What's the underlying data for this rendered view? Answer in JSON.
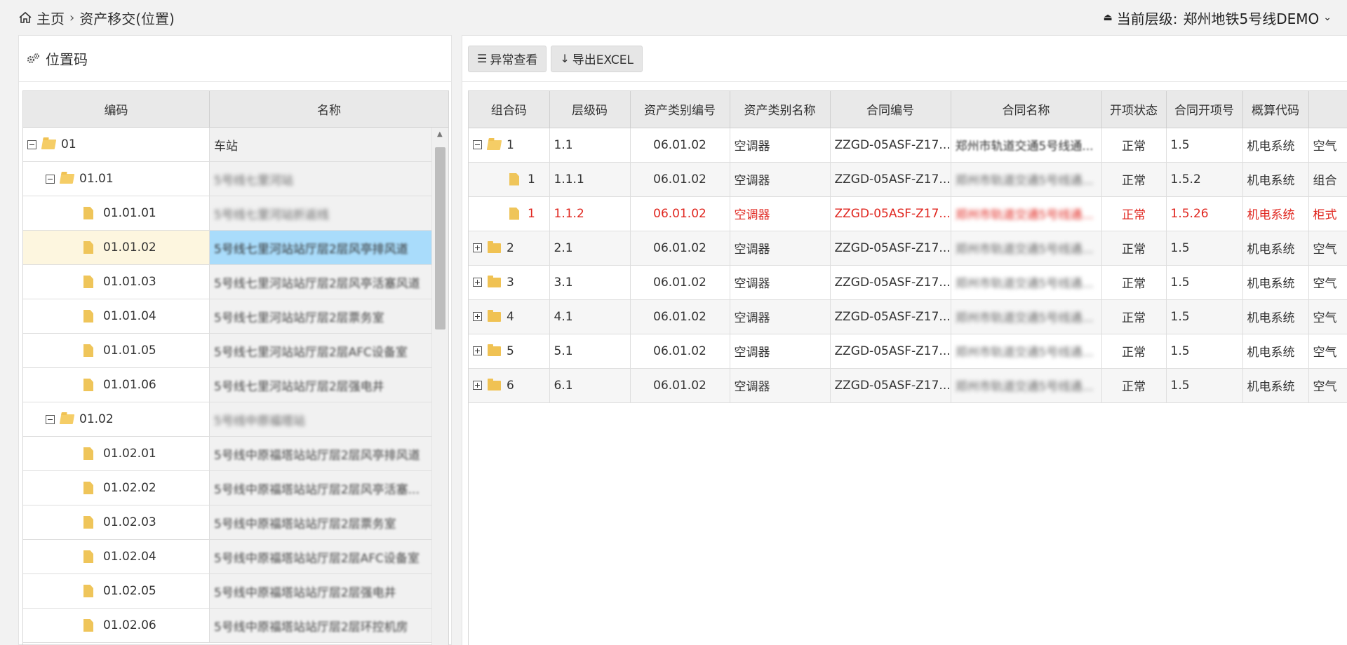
{
  "breadcrumb": {
    "home": "主页",
    "sep": "›",
    "current": "资产移交(位置)"
  },
  "level": {
    "label": "当前层级:",
    "value": "郑州地铁5号线DEMO"
  },
  "left_panel": {
    "title": "位置码",
    "columns": {
      "code": "编码",
      "name": "名称"
    },
    "rows": [
      {
        "code": "01",
        "name": "车站"
      },
      {
        "code": "01.01",
        "name": "5号线七里河站"
      },
      {
        "code": "01.01.01",
        "name": "5号线七里河站折返线"
      },
      {
        "code": "01.01.02",
        "name": "5号线七里河站站厅层2层风亭排风道"
      },
      {
        "code": "01.01.03",
        "name": "5号线七里河站站厅层2层风亭活塞风道"
      },
      {
        "code": "01.01.04",
        "name": "5号线七里河站站厅层2层票务室"
      },
      {
        "code": "01.01.05",
        "name": "5号线七里河站站厅层2层AFC设备室"
      },
      {
        "code": "01.01.06",
        "name": "5号线七里河站站厅层2层强电井"
      },
      {
        "code": "01.02",
        "name": "5号线中原福塔站"
      },
      {
        "code": "01.02.01",
        "name": "5号线中原福塔站站厅层2层风亭排风道"
      },
      {
        "code": "01.02.02",
        "name": "5号线中原福塔站站厅层2层风亭活塞..."
      },
      {
        "code": "01.02.03",
        "name": "5号线中原福塔站站厅层2层票务室"
      },
      {
        "code": "01.02.04",
        "name": "5号线中原福塔站站厅层2层AFC设备室"
      },
      {
        "code": "01.02.05",
        "name": "5号线中原福塔站站厅层2层强电井"
      },
      {
        "code": "01.02.06",
        "name": "5号线中原福塔站站厅层2层环控机房"
      }
    ]
  },
  "toolbar": {
    "abnormal_label": "异常查看",
    "export_label": "导出EXCEL"
  },
  "grid": {
    "columns": [
      "组合码",
      "层级码",
      "资产类别编号",
      "资产类别名称",
      "合同编号",
      "合同名称",
      "开项状态",
      "合同开项号",
      "概算代码",
      ""
    ],
    "rows": [
      {
        "combo": "1",
        "level": "1.1",
        "cat_no": "06.01.02",
        "cat_name": "空调器",
        "contract_no": "ZZGD-05ASF-Z17...",
        "contract_name": "郑州市轨道交通5号线通...",
        "status": "正常",
        "open_no": "1.5",
        "budget": "机电系统",
        "extra": "空气"
      },
      {
        "combo": "1",
        "level": "1.1.1",
        "cat_no": "06.01.02",
        "cat_name": "空调器",
        "contract_no": "ZZGD-05ASF-Z17...",
        "contract_name": "郑州市轨道交通5号线通...",
        "status": "正常",
        "open_no": "1.5.2",
        "budget": "机电系统",
        "extra": "组合"
      },
      {
        "combo": "1",
        "level": "1.1.2",
        "cat_no": "06.01.02",
        "cat_name": "空调器",
        "contract_no": "ZZGD-05ASF-Z17...",
        "contract_name": "郑州市轨道交通5号线通...",
        "status": "正常",
        "open_no": "1.5.26",
        "budget": "机电系统",
        "extra": "柜式"
      },
      {
        "combo": "2",
        "level": "2.1",
        "cat_no": "06.01.02",
        "cat_name": "空调器",
        "contract_no": "ZZGD-05ASF-Z17...",
        "contract_name": "郑州市轨道交通5号线通...",
        "status": "正常",
        "open_no": "1.5",
        "budget": "机电系统",
        "extra": "空气"
      },
      {
        "combo": "3",
        "level": "3.1",
        "cat_no": "06.01.02",
        "cat_name": "空调器",
        "contract_no": "ZZGD-05ASF-Z17...",
        "contract_name": "郑州市轨道交通5号线通...",
        "status": "正常",
        "open_no": "1.5",
        "budget": "机电系统",
        "extra": "空气"
      },
      {
        "combo": "4",
        "level": "4.1",
        "cat_no": "06.01.02",
        "cat_name": "空调器",
        "contract_no": "ZZGD-05ASF-Z17...",
        "contract_name": "郑州市轨道交通5号线通...",
        "status": "正常",
        "open_no": "1.5",
        "budget": "机电系统",
        "extra": "空气"
      },
      {
        "combo": "5",
        "level": "5.1",
        "cat_no": "06.01.02",
        "cat_name": "空调器",
        "contract_no": "ZZGD-05ASF-Z17...",
        "contract_name": "郑州市轨道交通5号线通...",
        "status": "正常",
        "open_no": "1.5",
        "budget": "机电系统",
        "extra": "空气"
      },
      {
        "combo": "6",
        "level": "6.1",
        "cat_no": "06.01.02",
        "cat_name": "空调器",
        "contract_no": "ZZGD-05ASF-Z17...",
        "contract_name": "郑州市轨道交通5号线通...",
        "status": "正常",
        "open_no": "1.5",
        "budget": "机电系统",
        "extra": "空气"
      }
    ]
  },
  "colors": {
    "highlight_red": "#e0261f",
    "selected_row": "#a9dcfb",
    "folder": "#f0c253"
  }
}
